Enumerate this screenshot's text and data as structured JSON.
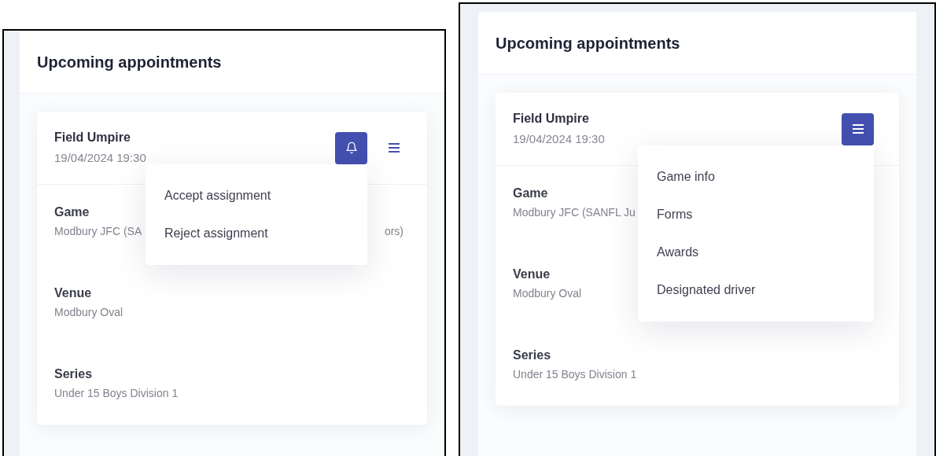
{
  "panels": [
    {
      "title": "Upcoming appointments",
      "framed": false,
      "card": {
        "role": "Field Umpire",
        "datetime": "19/04/2024 19:30",
        "buttons": [
          {
            "kind": "bell",
            "active": true
          },
          {
            "kind": "menu",
            "active": false
          }
        ],
        "menu": {
          "items": [
            "Accept assignment",
            "Reject assignment"
          ]
        },
        "fields": [
          {
            "label": "Game",
            "value": "Modbury JFC (SA",
            "value_end": "ors)"
          },
          {
            "label": "Venue",
            "value": "Modbury Oval"
          },
          {
            "label": "Series",
            "value": "Under 15 Boys Division 1"
          }
        ]
      }
    },
    {
      "title": "Upcoming appointments",
      "framed": true,
      "card": {
        "role": "Field Umpire",
        "datetime": "19/04/2024 19:30",
        "buttons": [
          {
            "kind": "menu",
            "active": true
          }
        ],
        "menu": {
          "items": [
            "Game info",
            "Forms",
            "Awards",
            "Designated driver"
          ]
        },
        "fields": [
          {
            "label": "Game",
            "value": "Modbury JFC (SANFL Ju"
          },
          {
            "label": "Venue",
            "value": "Modbury Oval"
          },
          {
            "label": "Series",
            "value": "Under 15 Boys Division 1"
          }
        ]
      }
    }
  ]
}
